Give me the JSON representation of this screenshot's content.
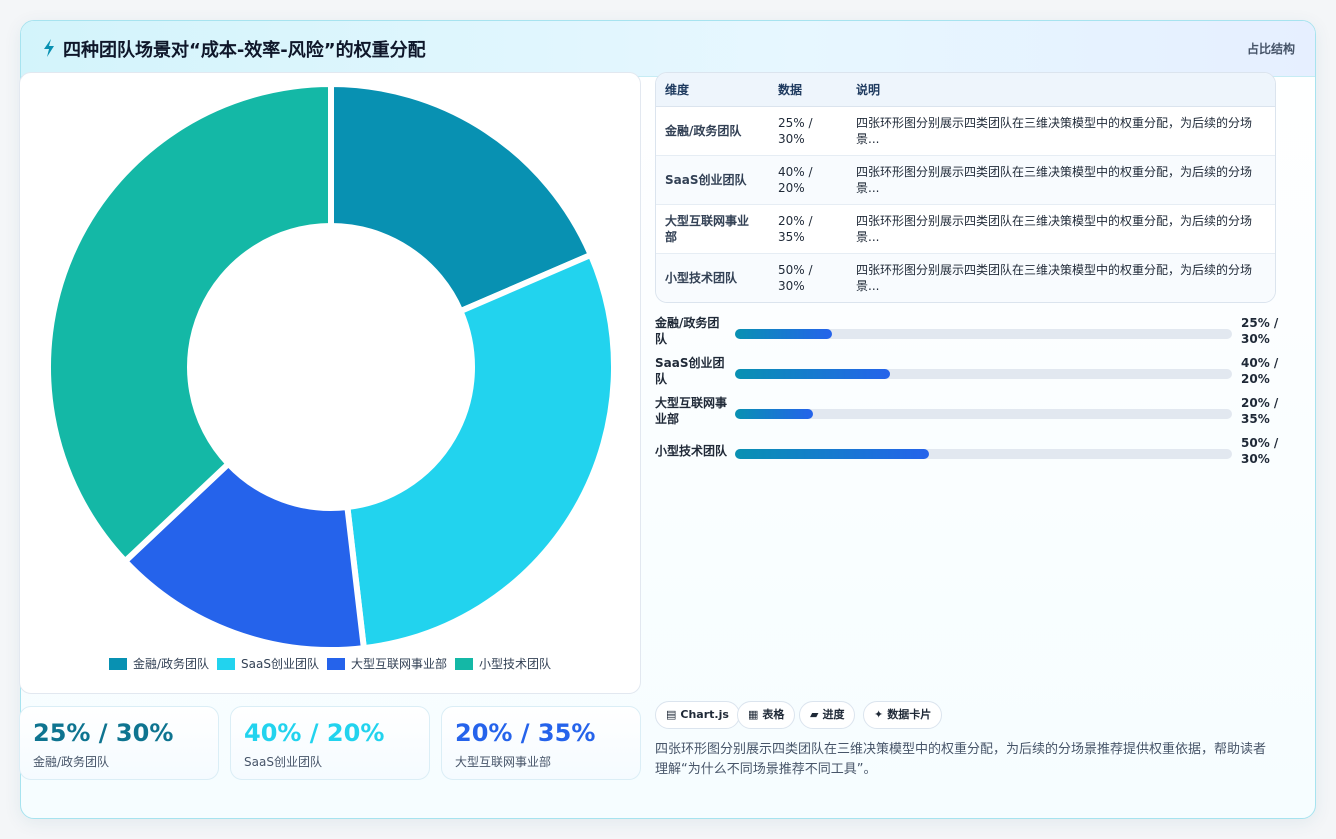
{
  "header": {
    "title": "四种团队场景对“成本-效率-风险”的权重分配",
    "tag": "占比结构"
  },
  "chart_data": {
    "type": "pie",
    "categories": [
      "金融/政务团队",
      "SaaS创业团队",
      "大型互联网事业部",
      "小型技术团队"
    ],
    "values": [
      25,
      40,
      20,
      50
    ],
    "colors": [
      "#0891b2",
      "#22d3ee",
      "#2563eb",
      "#14b8a6"
    ],
    "legend": "bottom"
  },
  "stats": [
    {
      "value": "25% / 30%",
      "label": "金融/政务团队",
      "color": "#0e7490"
    },
    {
      "value": "40% / 20%",
      "label": "SaaS创业团队",
      "color": "#22d3ee"
    },
    {
      "value": "20% / 35%",
      "label": "大型互联网事业部",
      "color": "#2563eb"
    }
  ],
  "table": {
    "headers": [
      "维度",
      "数据",
      "说明"
    ],
    "rows": [
      {
        "dim": "金融/政务团队",
        "data": "25% / 30%",
        "desc": "四张环形图分别展示四类团队在三维决策模型中的权重分配，为后续的分场景..."
      },
      {
        "dim": "SaaS创业团队",
        "data": "40% / 20%",
        "desc": "四张环形图分别展示四类团队在三维决策模型中的权重分配，为后续的分场景..."
      },
      {
        "dim": "大型互联网事业部",
        "data": "20% / 35%",
        "desc": "四张环形图分别展示四类团队在三维决策模型中的权重分配，为后续的分场景..."
      },
      {
        "dim": "小型技术团队",
        "data": "50% / 30%",
        "desc": "四张环形图分别展示四类团队在三维决策模型中的权重分配，为后续的分场景..."
      }
    ]
  },
  "progress": [
    {
      "name": "金融/政务团队",
      "value": "25% / 30%",
      "percent": 25
    },
    {
      "name": "SaaS创业团队",
      "value": "40% / 20%",
      "percent": 40
    },
    {
      "name": "大型互联网事业部",
      "value": "20% / 35%",
      "percent": 20
    },
    {
      "name": "小型技术团队",
      "value": "50% / 30%",
      "percent": 50
    }
  ],
  "chips": [
    {
      "icon": "chart-icon",
      "glyph": "▤",
      "label": "Chart.js"
    },
    {
      "icon": "table-icon",
      "glyph": "▦",
      "label": "表格"
    },
    {
      "icon": "progress-icon",
      "glyph": "▰",
      "label": "进度"
    },
    {
      "icon": "sparkle-icon",
      "glyph": "✦",
      "label": "数据卡片"
    }
  ],
  "note": "四张环形图分别展示四类团队在三维决策模型中的权重分配，为后续的分场景推荐提供权重依据，帮助读者理解“为什么不同场景推荐不同工具”。"
}
